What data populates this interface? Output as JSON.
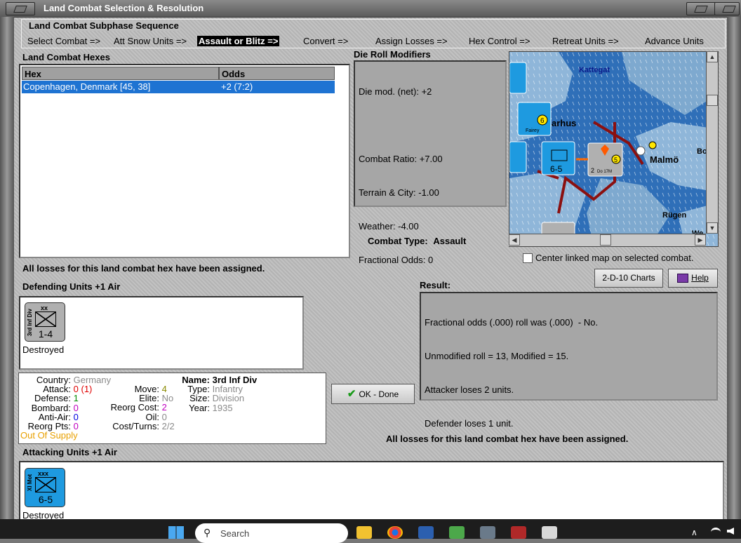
{
  "window": {
    "title": "Land Combat Selection & Resolution"
  },
  "subphase": {
    "caption": "Land Combat Subphase Sequence",
    "steps": [
      "Select Combat =>",
      "Att Snow Units =>",
      "Assault or Blitz =>",
      "Convert =>",
      "Assign Losses =>",
      "Hex Control =>",
      "Retreat Units =>",
      "Advance Units"
    ],
    "active_index": 2
  },
  "hexes": {
    "caption": "Land Combat Hexes",
    "col_hex": "Hex",
    "col_odds": "Odds",
    "rows": [
      {
        "hex": "Copenhagen, Denmark [45, 38]",
        "odds": "+2 (7:2)"
      }
    ]
  },
  "modifiers": {
    "caption": "Die Roll Modifiers",
    "lines": [
      "Die mod. (net): +2",
      "",
      "Combat Ratio: +7.00",
      "Terrain & City: -1.00",
      "Weather: -4.00",
      "Fractional Odds: 0"
    ]
  },
  "map": {
    "labels": [
      "Kattegat",
      "arhus",
      "Malmö",
      "Rügen",
      "Bo",
      "We"
    ],
    "counters": [
      "6",
      "Fairey",
      "6-5",
      "5",
      "Do 17M",
      "2"
    ]
  },
  "combat_type": {
    "label": "Combat Type:",
    "value": "Assault"
  },
  "center_map": {
    "label": "Center linked map on selected combat.",
    "checked": false
  },
  "buttons": {
    "charts": "2-D-10 Charts",
    "help": "Help",
    "ok": "OK - Done"
  },
  "losses_msg": "All losses for this land combat hex have been assigned.",
  "defending": {
    "caption": "Defending Units +1 Air",
    "units": [
      {
        "size": "xx",
        "side_label": "3rd Inf Div",
        "strength": "1-4",
        "status": "Destroyed"
      }
    ]
  },
  "result": {
    "caption": "Result:",
    "lines": [
      "Fractional odds (.000) roll was (.000)  - No.",
      "Unmodified roll = 13, Modified = 15.",
      "Attacker loses 2 units.",
      "Defender loses 1 unit."
    ]
  },
  "unit_info": {
    "country_label": "Country:",
    "country": "Germany",
    "attack_label": "Attack:",
    "attack": "0",
    "attack_paren": "(1)",
    "defense_label": "Defense:",
    "defense": "1",
    "bombard_label": "Bombard:",
    "bombard": "0",
    "antiair_label": "Anti-Air:",
    "antiair": "0",
    "reorgpts_label": "Reorg Pts:",
    "reorgpts": "0",
    "supply": "Out Of Supply",
    "move_label": "Move:",
    "move": "4",
    "elite_label": "Elite:",
    "elite": "No",
    "reorgcost_label": "Reorg Cost:",
    "reorgcost": "2",
    "oil_label": "Oil:",
    "oil": "0",
    "costturns_label": "Cost/Turns:",
    "costturns": "2/2",
    "name_label": "Name:",
    "name": "3rd Inf Div",
    "type_label": "Type:",
    "type": "Infantry",
    "size_label": "Size:",
    "size": "Division",
    "year_label": "Year:",
    "year": "1935"
  },
  "attacking": {
    "caption": "Attacking Units +1 Air",
    "units": [
      {
        "size": "xxx",
        "side_label": "XI Mot",
        "strength": "6-5",
        "status": "Destroyed"
      }
    ]
  },
  "taskbar": {
    "search_placeholder": "Search"
  },
  "colors": {
    "selection": "#1e73d2",
    "attacker_counter": "#1e9ae0",
    "defender_counter": "#b0b0b0",
    "sea": "#2f6fb8"
  }
}
